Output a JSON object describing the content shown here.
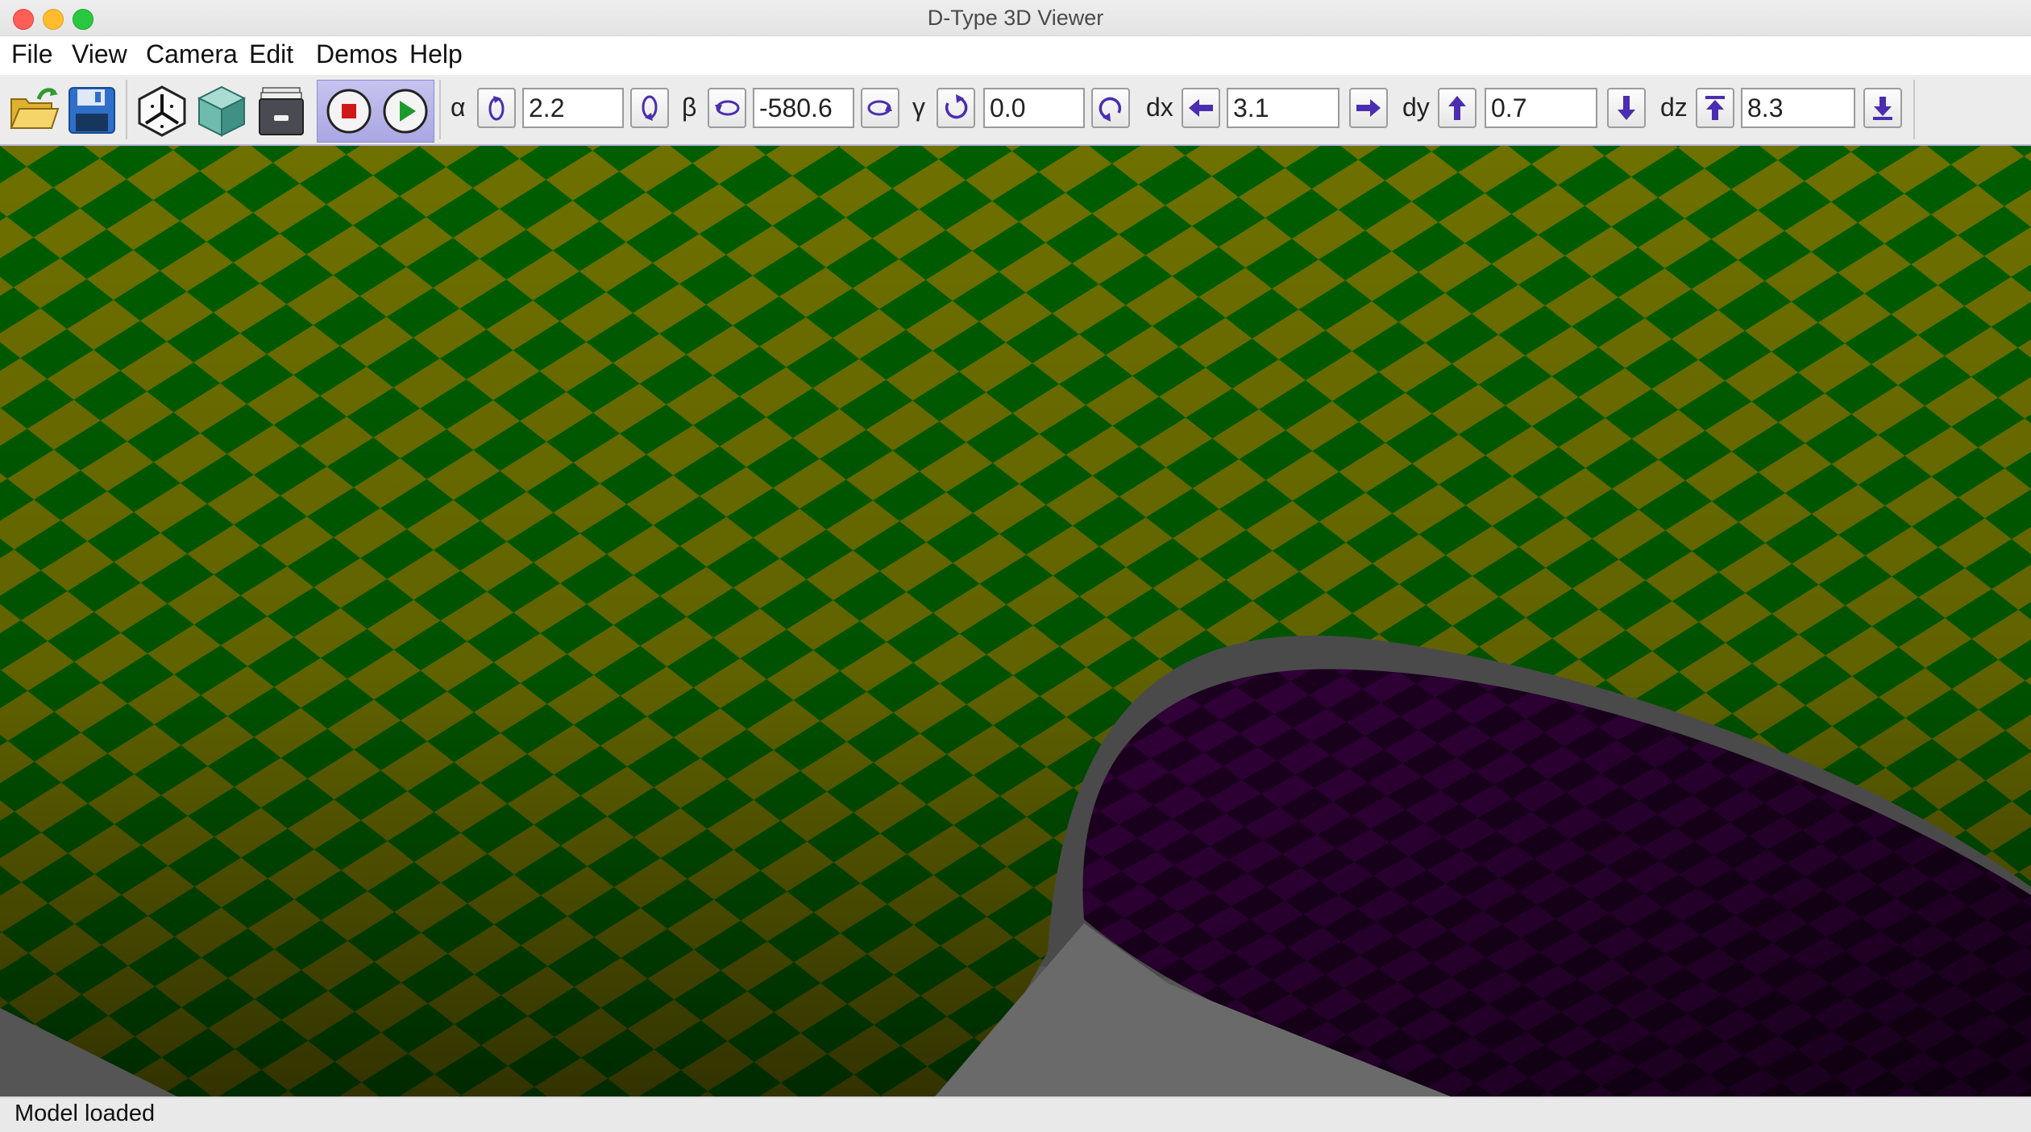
{
  "window": {
    "title": "D-Type 3D Viewer"
  },
  "menu": [
    "File",
    "View",
    "Camera",
    "Edit",
    "Demos",
    "Help"
  ],
  "toolbar": {
    "alpha": {
      "label": "α",
      "value": "2.2"
    },
    "beta": {
      "label": "β",
      "value": "-580.6"
    },
    "gamma": {
      "label": "γ",
      "value": "0.0"
    },
    "dx": {
      "label": "dx",
      "value": "3.1"
    },
    "dy": {
      "label": "dy",
      "value": "0.7"
    },
    "dz": {
      "label": "dz",
      "value": "8.3"
    }
  },
  "icons": {
    "open": "open-folder-icon",
    "save": "save-disk-icon",
    "axes": "axes-icon",
    "cube": "cube-icon",
    "archive": "archive-icon",
    "stop": "stop-icon",
    "play": "play-icon"
  },
  "colors": {
    "checker_green": "#005a00",
    "checker_yellow": "#707300",
    "inner_purple": "#2a0030",
    "ground": "#5a5a5a",
    "accent": "#4a2db0"
  },
  "status": {
    "text": "Model loaded"
  }
}
